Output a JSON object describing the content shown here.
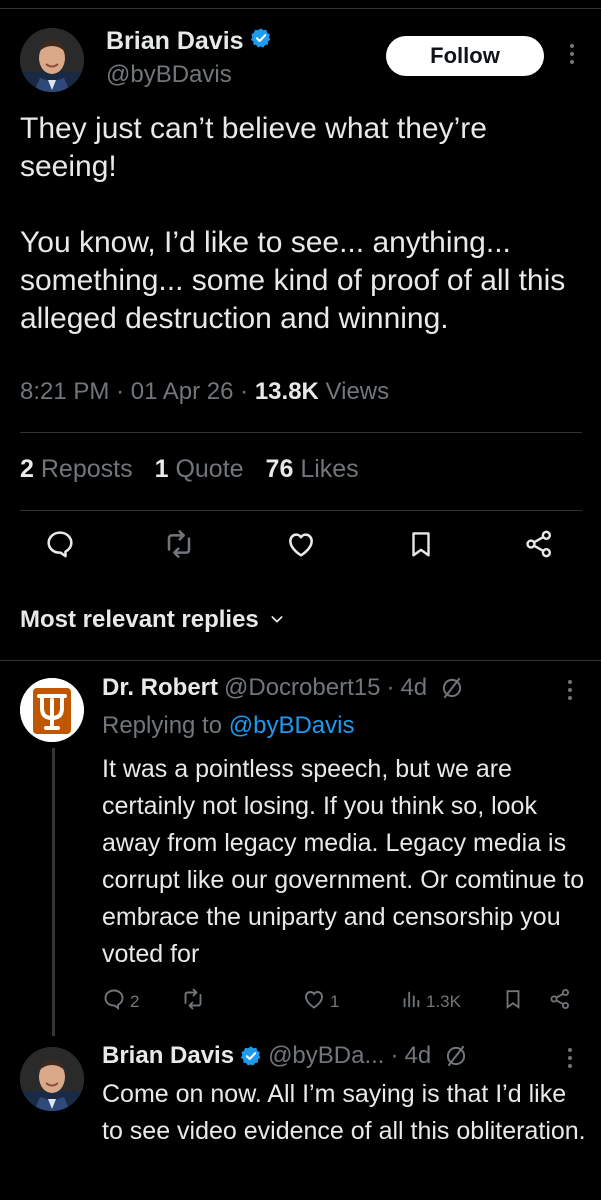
{
  "tweet": {
    "author_name": "Brian Davis",
    "author_handle": "@byBDavis",
    "follow_label": "Follow",
    "text": "They just can’t believe what they’re seeing!\n\nYou know, I’d like to see... anything... something... some kind of proof of all this alleged destruction and winning.",
    "time": "8:21 PM",
    "date": "01 Apr 26",
    "views_count": "13.8K",
    "views_label": "Views",
    "reposts_count": "2",
    "reposts_label": "Reposts",
    "quotes_count": "1",
    "quotes_label": "Quote",
    "likes_count": "76",
    "likes_label": "Likes"
  },
  "replies_header": "Most relevant replies",
  "replies": [
    {
      "name": "Dr. Robert",
      "handle": "@Docrobert15",
      "age": "4d",
      "replying_prefix": "Replying to",
      "replying_handle": "@byBDavis",
      "text": "It was a pointless speech, but we are certainly not losing. If you think so, look away from legacy media. Legacy media is corrupt like our government. Or comtinue to embrace the uniparty and censorship you voted for",
      "reply_count": "2",
      "like_count": "1",
      "views": "1.3K"
    },
    {
      "name": "Brian Davis",
      "handle": "@byBDa...",
      "age": "4d",
      "text": "Come on now. All I’m saying is that I’d like to see video evidence of all this obliteration."
    }
  ],
  "colors": {
    "accent": "#1d9bf0",
    "muted": "#71767b",
    "background": "#000000",
    "text": "#e7e9ea",
    "longhorn": "#bf5700"
  },
  "icons": [
    "verified-badge-icon",
    "more-icon",
    "reply-icon",
    "repost-icon",
    "like-icon",
    "bookmark-icon",
    "share-icon",
    "chevron-down-icon",
    "hide-icon",
    "views-icon"
  ]
}
